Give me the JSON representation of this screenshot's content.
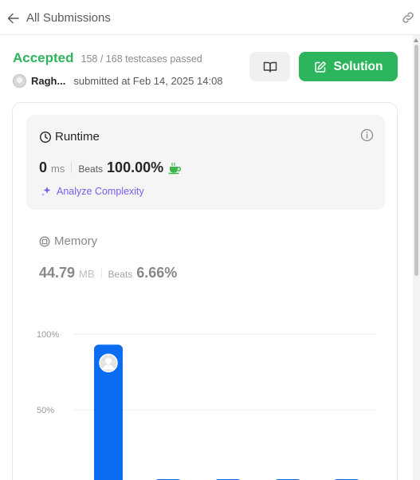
{
  "nav": {
    "back_label": "All Submissions"
  },
  "result": {
    "status": "Accepted",
    "testcases": "158 / 168 testcases passed",
    "author": "Ragh...",
    "submitted": "submitted at Feb 14, 2025 14:08"
  },
  "actions": {
    "solution_label": "Solution"
  },
  "runtime": {
    "title": "Runtime",
    "value": "0",
    "unit": "ms",
    "beats_label": "Beats",
    "beats_value": "100.00%",
    "analyze_label": "Analyze Complexity"
  },
  "memory": {
    "title": "Memory",
    "value": "44.79",
    "unit": "MB",
    "beats_label": "Beats",
    "beats_value": "6.66%"
  },
  "colors": {
    "accent_green": "#2db55d",
    "bar_blue": "#0a6cf0",
    "analyze_purple": "#7c5cf0"
  },
  "icons": [
    "arrow-left-icon",
    "link-icon",
    "book-icon",
    "edit-icon",
    "clock-icon",
    "info-icon",
    "sparkle-icon",
    "memory-chip-icon",
    "avatar-icon"
  ],
  "chart_data": {
    "type": "bar",
    "y_tick_labels": [
      "100%",
      "50%"
    ],
    "ylim": [
      0,
      100
    ],
    "values": [
      93,
      1,
      1,
      1,
      1
    ],
    "highlight_index": 0,
    "grid": true
  }
}
